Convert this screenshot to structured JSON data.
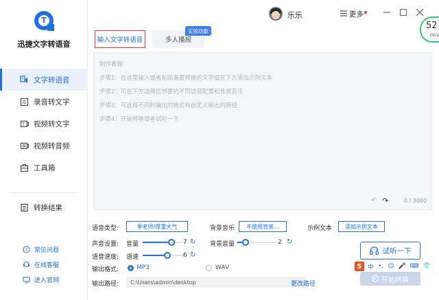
{
  "app": {
    "title": "迅捷文字转语音"
  },
  "sidebar": {
    "items": [
      {
        "label": "文字转语音",
        "icon": "text-to-speech-icon",
        "active": true
      },
      {
        "label": "录音转文字",
        "icon": "recording-icon",
        "active": false
      },
      {
        "label": "视频转文字",
        "icon": "video-to-text-icon",
        "active": false
      },
      {
        "label": "视频转音频",
        "icon": "video-to-audio-icon",
        "active": false
      },
      {
        "label": "工具箱",
        "icon": "toolbox-icon",
        "active": false
      }
    ],
    "result": {
      "label": "转换结果",
      "icon": "result-icon"
    },
    "help": [
      {
        "label": "常见问题",
        "icon": "question-icon"
      },
      {
        "label": "在线客服",
        "icon": "service-icon"
      },
      {
        "label": "进入官网",
        "icon": "website-icon"
      }
    ]
  },
  "topbar": {
    "username": "乐乐",
    "more_label": "更多",
    "speed_value": "52",
    "speed_unit": "0K/s"
  },
  "tabs": [
    {
      "label": "输入文字转语音",
      "active": true
    },
    {
      "label": "多人播报",
      "active": false
    }
  ],
  "tab_badge": "实验功能",
  "editor": {
    "steps": [
      "制作教程",
      "步骤1：在这里输入或者粘贴需要转换的文字或在下方添加示例文本",
      "步骤2：可在下方选择您想要的不同语音配置和背景音乐",
      "步骤3：可选择不同的输出的格式和自定义输出的路径",
      "步骤4：开始转换或者试听一下"
    ],
    "counter": "0 / 3000"
  },
  "settings": {
    "voice_type_label": "语音类型:",
    "voice_type_value": "季老师/厚重大气",
    "bg_music_label": "背景音乐",
    "bg_music_value": "不使用背景...",
    "sample_text_label": "示例文本",
    "sample_text_button": "添加示例文本",
    "sound_settings_label": "声音设置:",
    "volume_label": "音量",
    "volume_value": "7",
    "volume_max": 10,
    "bg_volume_label": "背景音量",
    "bg_volume_value": "2",
    "bg_volume_max": 10,
    "speed_label": "语音速度:",
    "rate_label": "语速",
    "rate_value": "6",
    "rate_max": 10,
    "format_label": "输出格式:",
    "format_options": [
      "MP3",
      "WAV"
    ],
    "format_selected": "MP3",
    "path_label": "输出路径:",
    "path_value": "C:\\Users\\admin\\desktop",
    "change_path": "更改路径"
  },
  "actions": {
    "preview": "试听一下",
    "start": "开始转换"
  },
  "ime": {
    "logo": "S",
    "items": [
      "中",
      "•,",
      "☺",
      "🎤",
      "⌨",
      "👕"
    ]
  },
  "colors": {
    "accent": "#1f6fe5",
    "highlight_border": "#e53935",
    "speed_ring": "#2ecc71"
  }
}
